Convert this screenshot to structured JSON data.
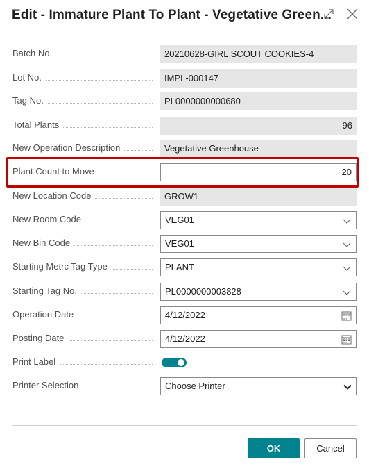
{
  "dialog": {
    "title": "Edit - Immature Plant To Plant - Vegetative Green...",
    "expand_icon": "expand-icon",
    "close_icon": "close-icon"
  },
  "fields": {
    "batch_no": {
      "label": "Batch No.",
      "value": "20210628-GIRL SCOUT COOKIES-4"
    },
    "lot_no": {
      "label": "Lot No.",
      "value": "IMPL-000147"
    },
    "tag_no": {
      "label": "Tag No.",
      "value": "PL0000000000680"
    },
    "total_plants": {
      "label": "Total Plants",
      "value": "96"
    },
    "new_operation_description": {
      "label": "New Operation Description",
      "value": "Vegetative Greenhouse"
    },
    "plant_count_to_move": {
      "label": "Plant Count to Move",
      "value": "20"
    },
    "new_location_code": {
      "label": "New Location Code",
      "value": "GROW1"
    },
    "new_room_code": {
      "label": "New Room Code",
      "value": "VEG01"
    },
    "new_bin_code": {
      "label": "New Bin Code",
      "value": "VEG01"
    },
    "starting_metrc_tag_type": {
      "label": "Starting Metrc Tag Type",
      "value": "PLANT"
    },
    "starting_tag_no": {
      "label": "Starting Tag No.",
      "value": "PL0000000003828"
    },
    "operation_date": {
      "label": "Operation Date",
      "value": "4/12/2022"
    },
    "posting_date": {
      "label": "Posting Date",
      "value": "4/12/2022"
    },
    "print_label": {
      "label": "Print Label",
      "value": true
    },
    "printer_selection": {
      "label": "Printer Selection",
      "value": "Choose Printer"
    }
  },
  "buttons": {
    "ok": "OK",
    "cancel": "Cancel"
  },
  "colors": {
    "accent": "#00838f",
    "highlight": "#c00000",
    "readonly_bg": "#e6e6e6"
  }
}
